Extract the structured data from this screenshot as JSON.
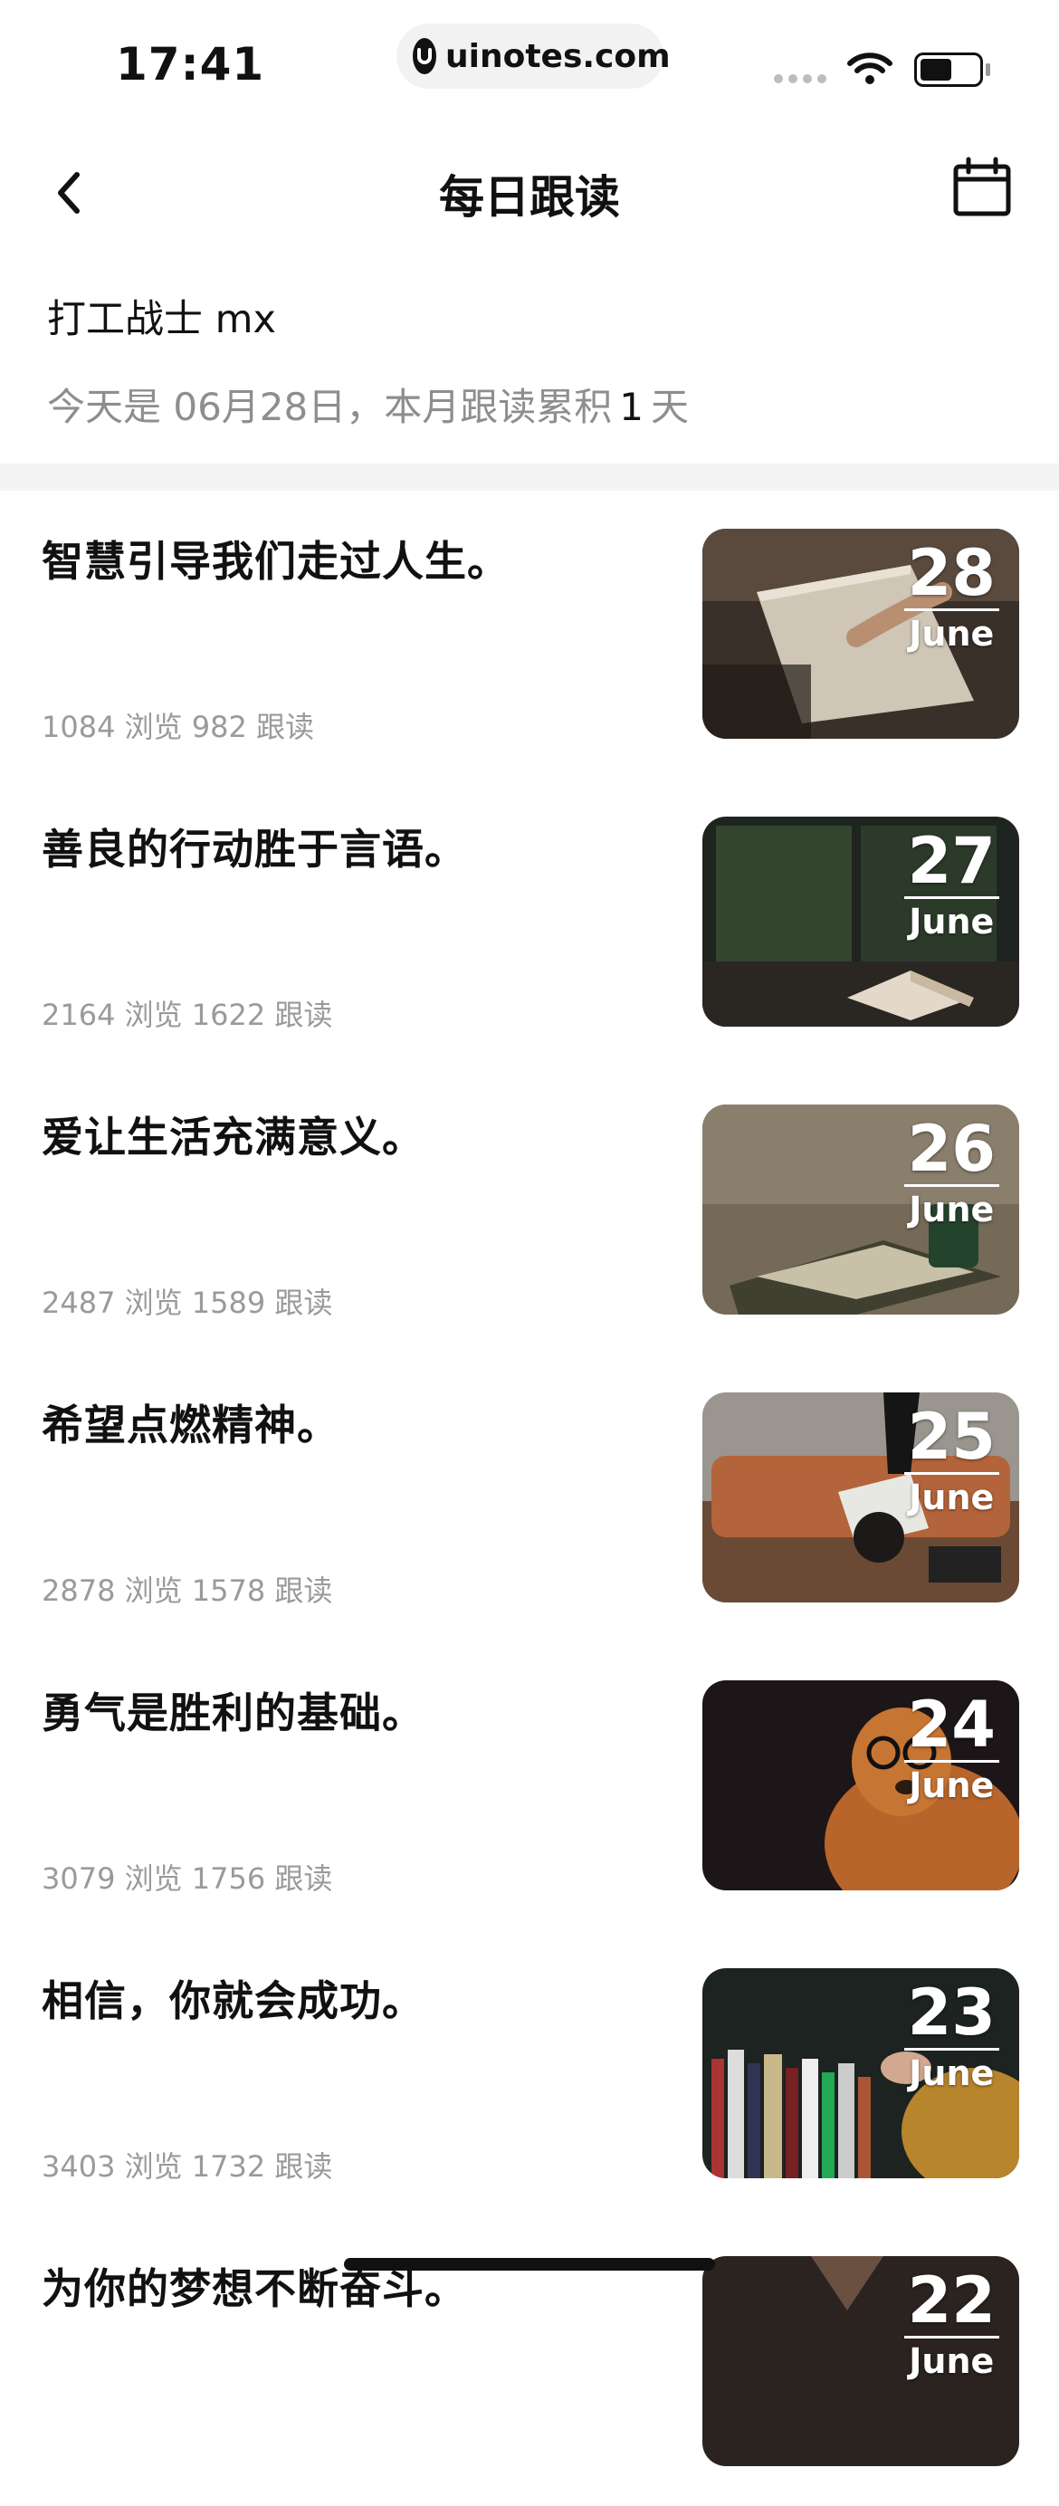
{
  "status": {
    "time": "17:41",
    "url": "uinotes.com"
  },
  "nav": {
    "title": "每日跟读"
  },
  "header": {
    "user_name": "打工战士 mx",
    "summary_prefix": "今天是 06月28日，本月跟读累积",
    "summary_count": "1",
    "summary_suffix": "天"
  },
  "items": [
    {
      "title": "智慧引导我们走过人生。",
      "stats": "1084 浏览 982 跟读",
      "day": "28",
      "month": "June",
      "image": "reading-book-hand"
    },
    {
      "title": "善良的行动胜于言语。",
      "stats": "2164 浏览 1622 跟读",
      "day": "27",
      "month": "June",
      "image": "book-by-window"
    },
    {
      "title": "爱让生活充满意义。",
      "stats": "2487 浏览 1589 跟读",
      "day": "26",
      "month": "June",
      "image": "book-and-mug"
    },
    {
      "title": "希望点燃精神。",
      "stats": "2878 浏览 1578 跟读",
      "day": "25",
      "month": "June",
      "image": "person-reading-on-sofa"
    },
    {
      "title": "勇气是胜利的基础。",
      "stats": "3079 浏览 1756 跟读",
      "day": "24",
      "month": "June",
      "image": "dog-with-glasses"
    },
    {
      "title": "相信，你就会成功。",
      "stats": "3403 浏览 1732 跟读",
      "day": "23",
      "month": "June",
      "image": "bookshelf-hand"
    },
    {
      "title": "为你的梦想不断奋斗。",
      "stats": "",
      "day": "22",
      "month": "June",
      "image": "partial"
    }
  ]
}
